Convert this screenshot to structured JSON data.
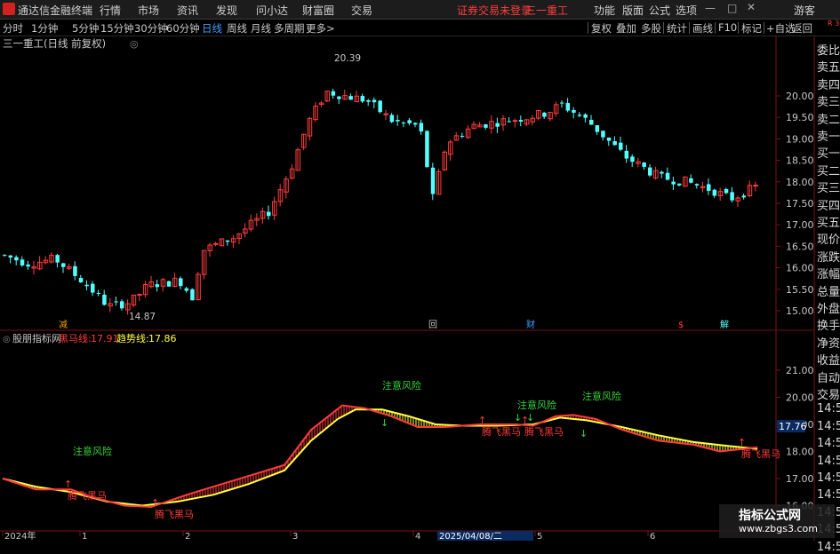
{
  "menu": {
    "app_title": "通达信金融终端",
    "items": [
      "行情",
      "市场",
      "资讯",
      "发现",
      "问小达",
      "财富圈",
      "交易"
    ],
    "login_status": "证券交易未登录",
    "stock_name": "三一重工",
    "right_items": [
      "功能",
      "版面",
      "公式",
      "选项"
    ],
    "guest": "游客"
  },
  "toolbar": {
    "periods": [
      "分时",
      "1分钟",
      "5分钟",
      "15分钟",
      "30分钟",
      "60分钟",
      "日线",
      "周线",
      "月线",
      "多周期",
      "更多>"
    ],
    "active_period": "日线",
    "right_buttons": [
      "复权",
      "叠加",
      "多股",
      "统计",
      "画线",
      "F10",
      "标记",
      "+自选",
      "返回"
    ]
  },
  "chart_header": {
    "stock_label": "三一重工(日线 前复权)",
    "high_label": "20.39",
    "low_label": "14.87"
  },
  "price_axis": [
    "20.00",
    "19.50",
    "19.00",
    "18.50",
    "18.00",
    "17.50",
    "17.00",
    "16.50",
    "16.00",
    "15.50",
    "15.00"
  ],
  "event_markers": [
    "减",
    "回",
    "财",
    "$",
    "解"
  ],
  "indicator": {
    "name": "股朋指标网",
    "line1_label": "黑马线:",
    "line1_value": "17.91",
    "line2_label": "趋势线:",
    "line2_value": "17.86",
    "axis": [
      "21.00",
      "20.00",
      "19.00",
      "18.00",
      "17.00",
      "16.00"
    ],
    "current_value": "17.76",
    "signals": [
      "注意风险",
      "注意风险",
      "注意风险",
      "注意风险",
      "腾飞黑马",
      "腾飞黑马",
      "腾飞黑马",
      "腾飞黑马",
      "腾飞黑马"
    ]
  },
  "date_axis": [
    "2024年",
    "1",
    "2",
    "3",
    "4",
    "5",
    "6"
  ],
  "date_cursor": "2025/04/08/二",
  "sidebar": {
    "top": "R\n300",
    "items": [
      "委比",
      "卖五",
      "卖四",
      "卖三",
      "卖二",
      "卖一",
      "买一",
      "买二",
      "买三",
      "买四",
      "买五",
      "现价",
      "涨跌",
      "涨幅",
      "总量",
      "外盘",
      "换手",
      "净资",
      "收益",
      "自动",
      "交易",
      "14:5",
      "14:5",
      "14:5",
      "14:5",
      "14:5",
      "14:5",
      "14:5",
      "14:5",
      "14:5"
    ]
  },
  "watermark": {
    "text": "指标公式网",
    "url": "www.zbgs3.com"
  },
  "colors": {
    "up": "#ff3c3c",
    "down": "#54ffff",
    "yellow_line": "#ffff40",
    "signal_green": "#36d536",
    "background": "#000000"
  },
  "chart_data": {
    "type": "candlestick",
    "price_range": [
      14.8,
      20.5
    ],
    "high": 20.39,
    "low": 14.87,
    "indicator_lines": {
      "黑马线": 17.91,
      "趋势线": 17.86
    }
  }
}
